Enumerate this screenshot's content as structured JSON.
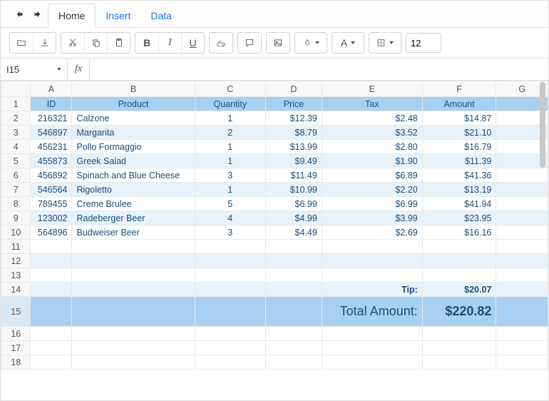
{
  "tabs": {
    "home": "Home",
    "insert": "Insert",
    "data": "Data"
  },
  "fontSize": "12",
  "cellRef": "I15",
  "fxLabel": "fx",
  "columns": [
    "A",
    "B",
    "C",
    "D",
    "E",
    "F",
    "G"
  ],
  "headers": {
    "id": "ID",
    "product": "Product",
    "quantity": "Quantity",
    "price": "Price",
    "tax": "Tax",
    "amount": "Amount"
  },
  "rows": [
    {
      "id": "216321",
      "product": "Calzone",
      "quantity": "1",
      "price": "$12.39",
      "tax": "$2.48",
      "amount": "$14.87"
    },
    {
      "id": "546897",
      "product": "Margarita",
      "quantity": "2",
      "price": "$8.79",
      "tax": "$3.52",
      "amount": "$21.10"
    },
    {
      "id": "456231",
      "product": "Pollo Formaggio",
      "quantity": "1",
      "price": "$13.99",
      "tax": "$2.80",
      "amount": "$16.79"
    },
    {
      "id": "455873",
      "product": "Greek Salad",
      "quantity": "1",
      "price": "$9.49",
      "tax": "$1.90",
      "amount": "$11.39"
    },
    {
      "id": "456892",
      "product": "Spinach and Blue Cheese",
      "quantity": "3",
      "price": "$11.49",
      "tax": "$6.89",
      "amount": "$41.36"
    },
    {
      "id": "546564",
      "product": "Rigoletto",
      "quantity": "1",
      "price": "$10.99",
      "tax": "$2.20",
      "amount": "$13.19"
    },
    {
      "id": "789455",
      "product": "Creme Brulee",
      "quantity": "5",
      "price": "$6.99",
      "tax": "$6.99",
      "amount": "$41.94"
    },
    {
      "id": "123002",
      "product": "Radeberger Beer",
      "quantity": "4",
      "price": "$4.99",
      "tax": "$3.99",
      "amount": "$23.95"
    },
    {
      "id": "564896",
      "product": "Budweiser Beer",
      "quantity": "3",
      "price": "$4.49",
      "tax": "$2.69",
      "amount": "$16.16"
    }
  ],
  "tip": {
    "label": "Tip:",
    "value": "$20.07"
  },
  "total": {
    "label": "Total Amount:",
    "value": "$220.82"
  },
  "chart_data": {
    "type": "table",
    "title": "",
    "columns": [
      "ID",
      "Product",
      "Quantity",
      "Price",
      "Tax",
      "Amount"
    ],
    "data": [
      [
        216321,
        "Calzone",
        1,
        12.39,
        2.48,
        14.87
      ],
      [
        546897,
        "Margarita",
        2,
        8.79,
        3.52,
        21.1
      ],
      [
        456231,
        "Pollo Formaggio",
        1,
        13.99,
        2.8,
        16.79
      ],
      [
        455873,
        "Greek Salad",
        1,
        9.49,
        1.9,
        11.39
      ],
      [
        456892,
        "Spinach and Blue Cheese",
        3,
        11.49,
        6.89,
        41.36
      ],
      [
        546564,
        "Rigoletto",
        1,
        10.99,
        2.2,
        13.19
      ],
      [
        789455,
        "Creme Brulee",
        5,
        6.99,
        6.99,
        41.94
      ],
      [
        123002,
        "Radeberger Beer",
        4,
        4.99,
        3.99,
        23.95
      ],
      [
        564896,
        "Budweiser Beer",
        3,
        4.49,
        2.69,
        16.16
      ]
    ],
    "summary": {
      "Tip": 20.07,
      "Total Amount": 220.82
    }
  }
}
